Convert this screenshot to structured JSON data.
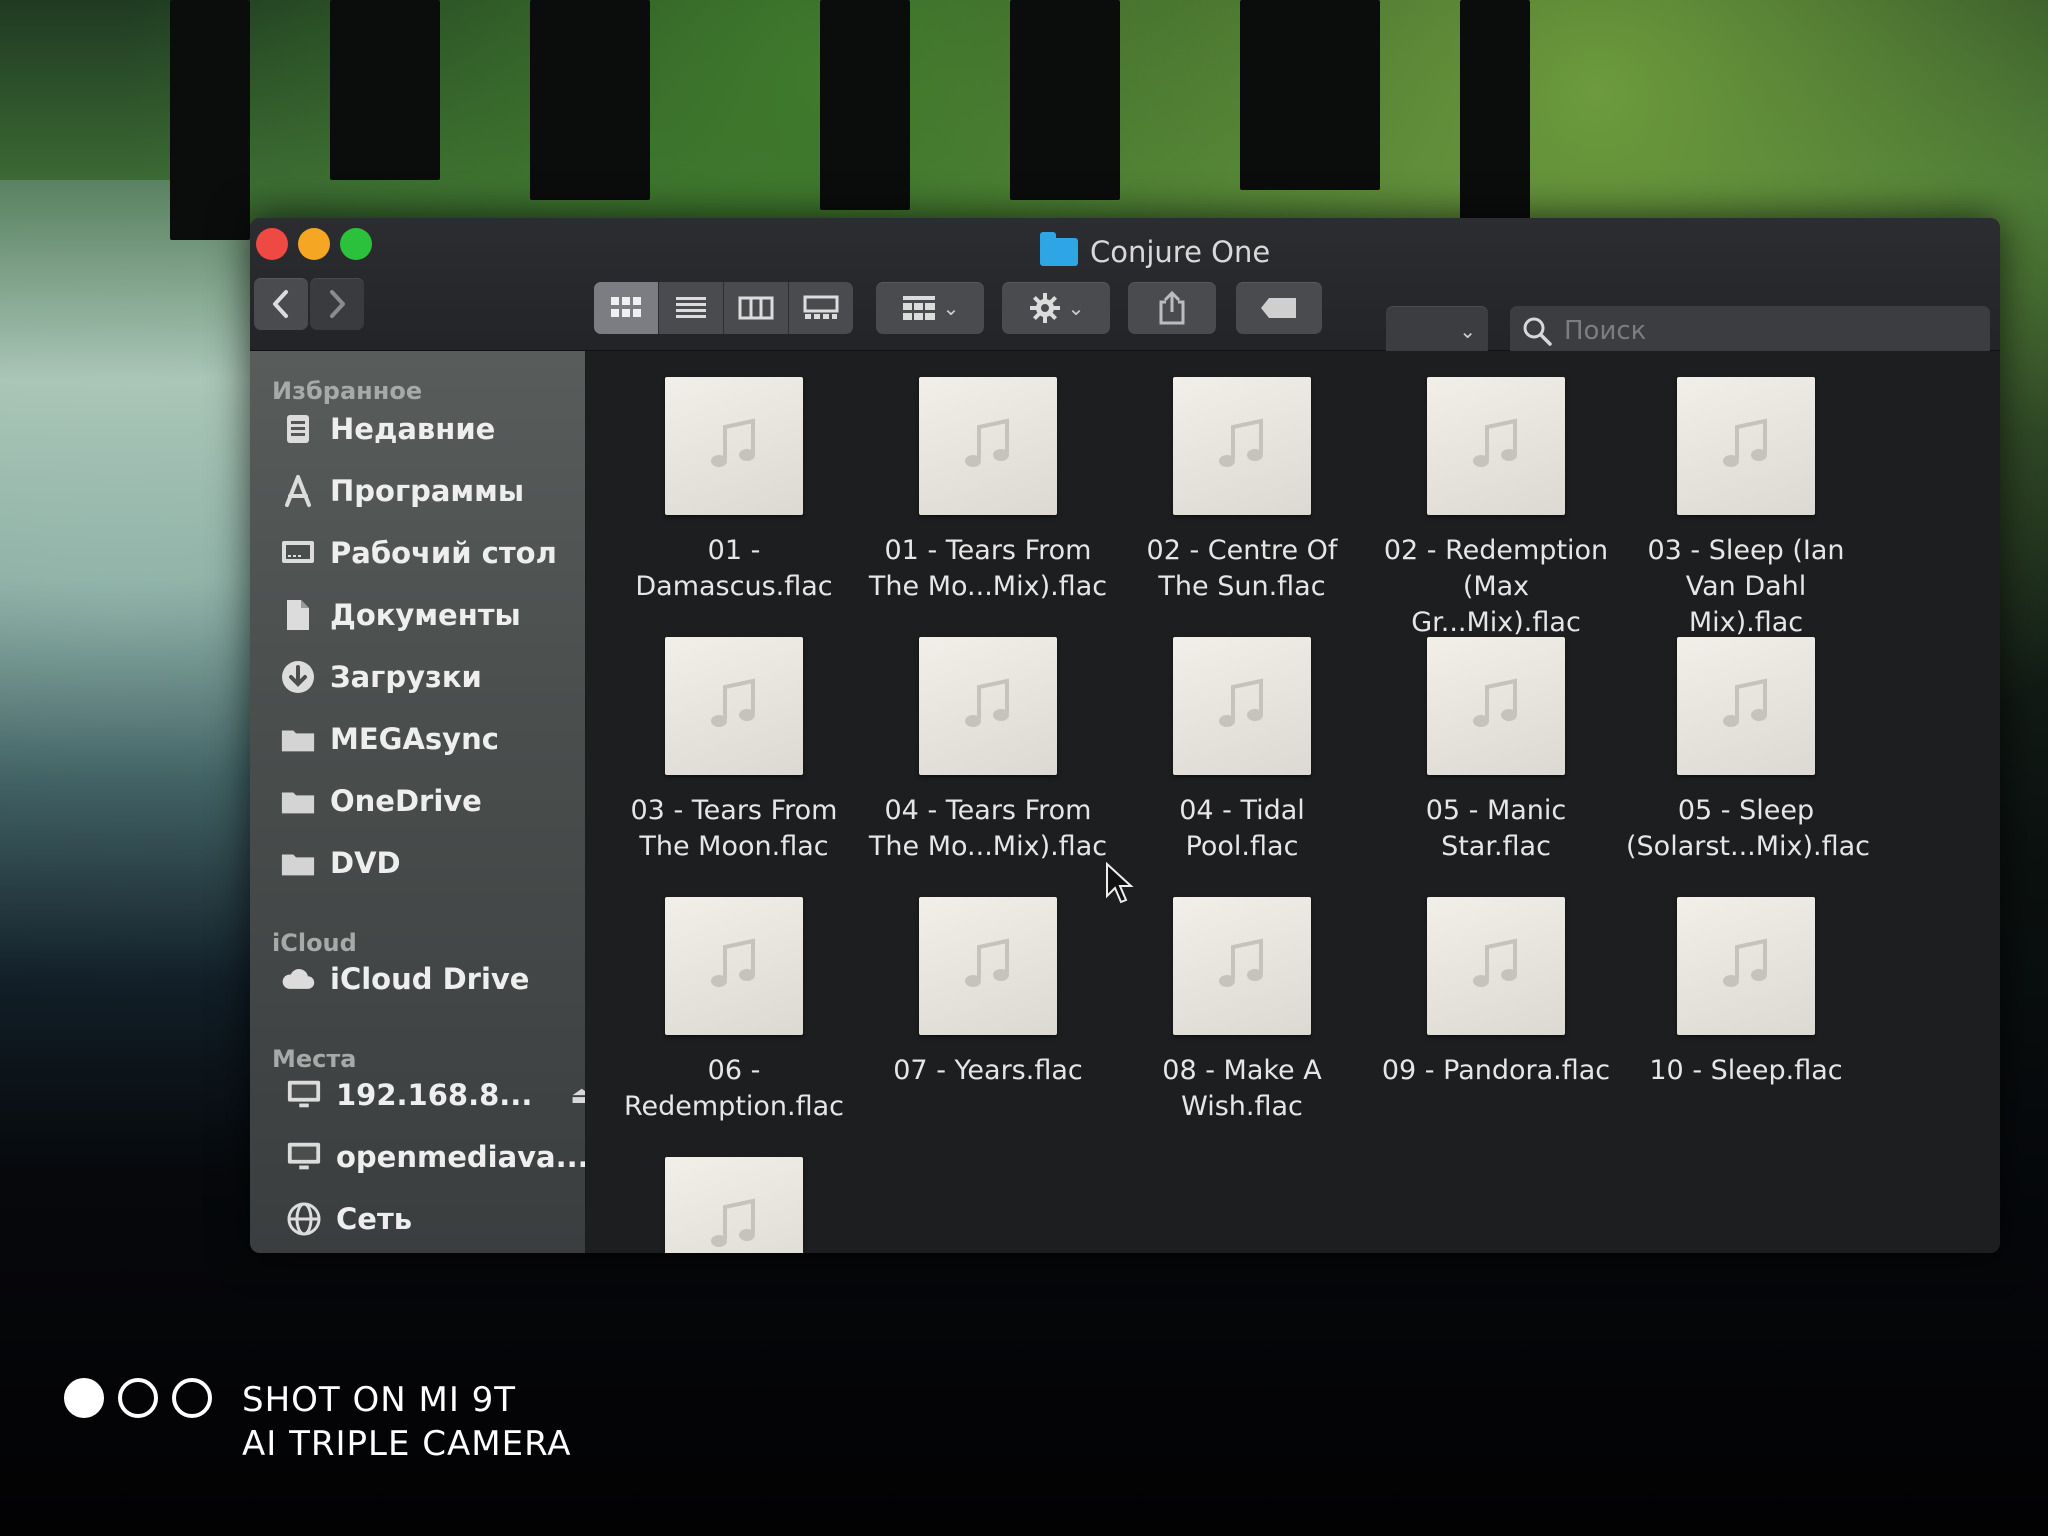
{
  "window": {
    "title": "Conjure One",
    "nav": {
      "back": "back-arrow",
      "forward": "forward-arrow"
    },
    "view_modes": [
      "icons",
      "list",
      "columns",
      "gallery"
    ],
    "active_view": "icons",
    "search_placeholder": "Поиск"
  },
  "sidebar": {
    "favorites_title": "Избранное",
    "favorites": [
      {
        "label": "Недавние",
        "icon": "recents-icon"
      },
      {
        "label": "Программы",
        "icon": "applications-icon"
      },
      {
        "label": "Рабочий стол",
        "icon": "desktop-icon"
      },
      {
        "label": "Документы",
        "icon": "documents-icon"
      },
      {
        "label": "Загрузки",
        "icon": "downloads-icon"
      },
      {
        "label": "MEGAsync",
        "icon": "folder-icon"
      },
      {
        "label": "OneDrive",
        "icon": "folder-icon"
      },
      {
        "label": "DVD",
        "icon": "folder-icon"
      }
    ],
    "icloud_title": "iCloud",
    "icloud": [
      {
        "label": "iCloud Drive",
        "icon": "cloud-icon"
      }
    ],
    "places_title": "Места",
    "places": [
      {
        "label": "192.168.8...",
        "icon": "monitor-icon"
      },
      {
        "label": "openmediava...",
        "icon": "monitor-icon"
      },
      {
        "label": "Сеть",
        "icon": "network-icon"
      }
    ]
  },
  "files": [
    {
      "name": "01 - Damascus.flac"
    },
    {
      "name": "01 - Tears From The Mo...Mix).flac"
    },
    {
      "name": "02 - Centre Of The Sun.flac"
    },
    {
      "name": "02 - Redemption (Max Gr...Mix).flac"
    },
    {
      "name": "03 - Sleep (Ian Van Dahl Mix).flac"
    },
    {
      "name": "03 - Tears From The Moon.flac"
    },
    {
      "name": "04 - Tears From The Mo...Mix).flac"
    },
    {
      "name": "04 - Tidal Pool.flac"
    },
    {
      "name": "05 - Manic Star.flac"
    },
    {
      "name": "05 - Sleep (Solarst...Mix).flac"
    },
    {
      "name": "06 - Redemption.flac"
    },
    {
      "name": "07 - Years.flac"
    },
    {
      "name": "08 - Make A Wish.flac"
    },
    {
      "name": "09 - Pandora.flac"
    },
    {
      "name": "10 - Sleep.flac"
    },
    {
      "name": ""
    }
  ],
  "watermark": {
    "line1": "SHOT ON MI 9T",
    "line2": "AI TRIPLE CAMERA"
  },
  "colors": {
    "close": "#ee4a43",
    "minimize": "#f5a623",
    "maximize": "#2bc13c",
    "folder_accent": "#2ea6e6"
  }
}
